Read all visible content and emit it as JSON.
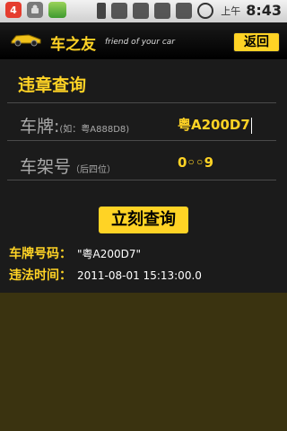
{
  "status_bar": {
    "notification_count": "4",
    "time_ampm": "上午",
    "time": "8:43",
    "icons": [
      "android-icon",
      "app-icon",
      "bluetooth-icon",
      "data-icon",
      "signal-icon",
      "wifi-icon",
      "battery-icon",
      "alarm-icon"
    ]
  },
  "header": {
    "title": "车之友",
    "subtitle": "friend of your car",
    "back_label": "返回"
  },
  "section": {
    "title": "违章查询"
  },
  "form": {
    "plate_label": "车牌:",
    "plate_hint": "(如：粤A888D8)",
    "plate_value": "粤A200D7",
    "frame_label": "车架号",
    "frame_hint": "（后四位）",
    "frame_value": "0◦◦9"
  },
  "actions": {
    "query_label": "立刻查询"
  },
  "results": {
    "plate_label": "车牌号码：",
    "plate_value": "\"粤A200D7\"",
    "time_label": "违法时间：",
    "time_value": "2011-08-01 15:13:00.0",
    "partial_label": "违法"
  },
  "colors": {
    "accent": "#ffd325",
    "panel": "#1b1b1b"
  }
}
